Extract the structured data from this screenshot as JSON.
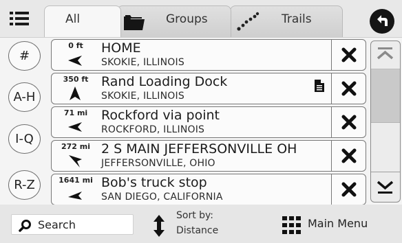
{
  "tabs": [
    {
      "label": "All",
      "icon": "list-icon",
      "active": true
    },
    {
      "label": "Groups",
      "icon": "folder-icon",
      "active": false
    },
    {
      "label": "Trails",
      "icon": "trail-dots-icon",
      "active": false
    }
  ],
  "back_icon": "back-arrow-icon",
  "alpha_index": [
    "#",
    "A-H",
    "I-Q",
    "R-Z"
  ],
  "locations": [
    {
      "distance": "0 ft",
      "name": "HOME",
      "place": "SKOKIE, ILLINOIS",
      "direction": "left",
      "has_note": false
    },
    {
      "distance": "350 ft",
      "name": "Rand Loading Dock",
      "place": "SKOKIE, ILLINOIS",
      "direction": "up",
      "has_note": true
    },
    {
      "distance": "71 mi",
      "name": "Rockford via point",
      "place": "ROCKFORD, ILLINOIS",
      "direction": "left",
      "has_note": false
    },
    {
      "distance": "272 mi",
      "name": "2 S MAIN JEFFERSONVILLE OH",
      "place": "JEFFERSONVILLE, OHIO",
      "direction": "down-left",
      "has_note": false
    },
    {
      "distance": "1641 mi",
      "name": "Bob's truck stop",
      "place": "SAN DIEGO, CALIFORNIA",
      "direction": "left",
      "has_note": false
    }
  ],
  "bottom": {
    "search_label": "Search",
    "sort_line1": "Sort by:",
    "sort_line2": "Distance",
    "main_menu_label": "Main Menu"
  }
}
